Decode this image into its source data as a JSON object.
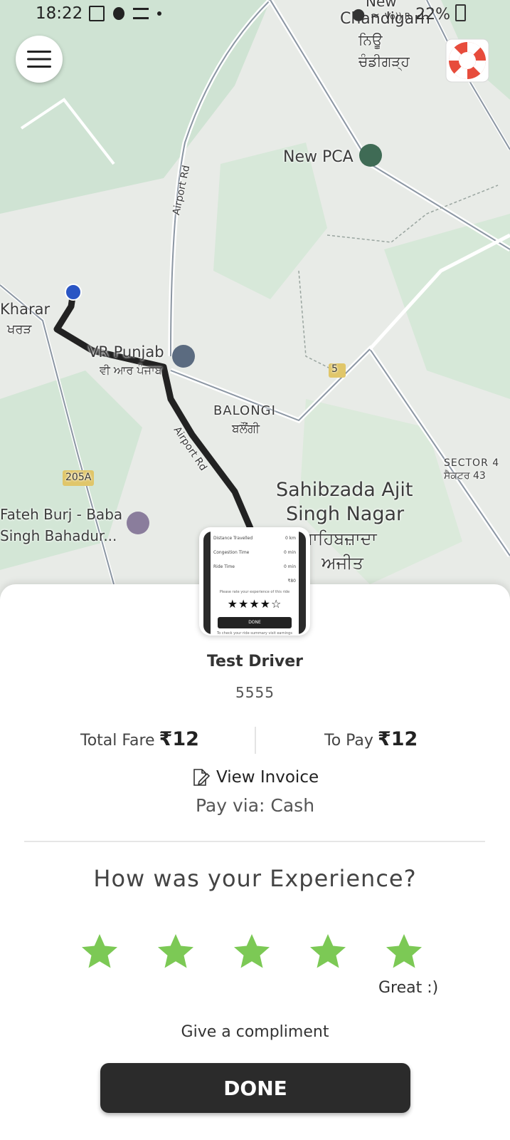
{
  "status_bar": {
    "time": "18:22",
    "network_text": "Vo)) R",
    "battery": "22%"
  },
  "map": {
    "labels": {
      "chandigarh_new": "New",
      "chandigarh": "Chandigarh",
      "chandigarh_pa1": "ਨਿਊ",
      "chandigarh_pa2": "ਚੰਡੀਗੜ੍ਹ",
      "new_pca": "New PCA",
      "airport_rd_1": "Airport Rd",
      "airport_rd_2": "Airport Rd",
      "kharar": "Kharar",
      "kharar_pa": "ਖਰੜ",
      "vr_punjab": "VR Punjab",
      "vr_punjab_pa": "ਵੀ ਆਰ ਪੰਜਾਬ",
      "balongi": "BALONGI",
      "balongi_pa": "ਬਲੌਂਗੀ",
      "route_5": "5",
      "route_205a": "205A",
      "sector43": "SECTOR 4",
      "sector43_pa": "ਸੈਕਟਰ 43",
      "sahibzada_1": "Sahibzada Ajit",
      "sahibzada_2": "Singh Nagar",
      "sahibzada_pa1": "ਸਾਹਿਬਜ਼ਾਦਾ",
      "sahibzada_pa2": "ਅਜੀਤ",
      "fateh_1": "Fateh Burj - Baba",
      "fateh_2": "Singh Bahadur..."
    }
  },
  "thumbnail": {
    "row1_label": "Distance Travelled",
    "row1_value": "0 km",
    "row2_label": "Congestion Time",
    "row2_value": "0 min",
    "row3_label": "Ride Time",
    "row3_value": "0 min",
    "fare": "₹80",
    "prompt": "Please rate your experience of this ride",
    "stars": "★★★★☆",
    "done": "DONE",
    "footer": "To check your ride summary visit earnings"
  },
  "driver": {
    "name": "Test Driver",
    "id": "5555"
  },
  "fare": {
    "total_label": "Total Fare",
    "total_value": "₹12",
    "to_pay_label": "To Pay",
    "to_pay_value": "₹12"
  },
  "invoice": {
    "label": "View Invoice",
    "icon": "edit-document-icon"
  },
  "payment": {
    "text": "Pay via: Cash"
  },
  "rating": {
    "question": "How was your Experience?",
    "stars_selected": 5,
    "stars_max": 5,
    "star_color": "#7cc955",
    "label": "Great :)"
  },
  "compliment": {
    "label": "Give a compliment"
  },
  "done_button": {
    "label": "DONE"
  }
}
